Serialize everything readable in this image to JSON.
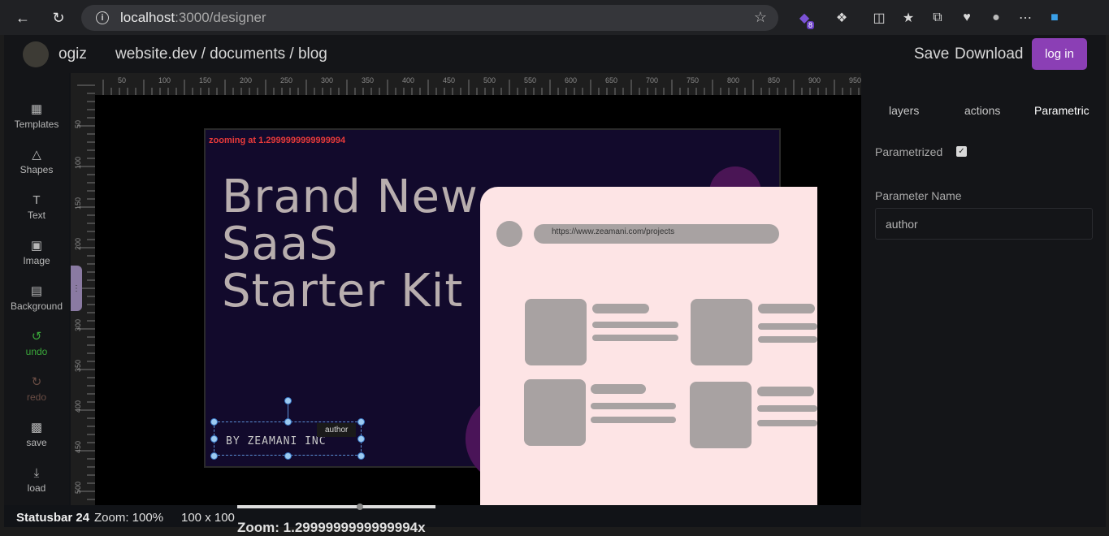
{
  "browser": {
    "url_host": "localhost",
    "url_path": ":3000/designer",
    "extension_badge": "8"
  },
  "header": {
    "username": "ogiz",
    "breadcrumb": "website.dev / documents / blog",
    "save_label": "Save",
    "download_label": "Download",
    "login_label": "log in"
  },
  "sidebar": {
    "items": [
      {
        "label": "Templates",
        "icon": "grid-icon"
      },
      {
        "label": "Shapes",
        "icon": "shapes-icon"
      },
      {
        "label": "Text",
        "icon": "text-icon"
      },
      {
        "label": "Image",
        "icon": "image-icon"
      },
      {
        "label": "Background",
        "icon": "hatch-icon"
      },
      {
        "label": "undo",
        "icon": "undo-icon"
      },
      {
        "label": "redo",
        "icon": "redo-icon"
      },
      {
        "label": "save",
        "icon": "floppy-icon"
      },
      {
        "label": "load",
        "icon": "download-icon"
      }
    ]
  },
  "rulers": {
    "top": [
      "50",
      "100",
      "150",
      "200",
      "250",
      "300",
      "350",
      "400",
      "450",
      "500",
      "550",
      "600",
      "650",
      "700",
      "750",
      "800",
      "850",
      "900",
      "950"
    ],
    "left": [
      "50",
      "100",
      "150",
      "200",
      "250",
      "300",
      "350",
      "400",
      "450",
      "500"
    ]
  },
  "canvas": {
    "zoom_message": "zooming at 1.2999999999999994",
    "headline_lines": [
      "Brand New",
      "SaaS",
      "Starter Kit"
    ],
    "mock_url": "https://www.zeamani.com/projects",
    "author_text": "BY ZEAMANI INC",
    "author_badge": "author"
  },
  "statusbar": {
    "label": "Statusbar 24",
    "zoom": "Zoom: 100%",
    "size": "100 x 100",
    "zoom_detail": "Zoom: 1.2999999999999994x"
  },
  "right_panel": {
    "tabs": [
      "layers",
      "actions",
      "Parametric"
    ],
    "active_tab": "Parametric",
    "parametrized_label": "Parametrized",
    "parametrized_checked": true,
    "parameter_name_label": "Parameter Name",
    "parameter_name_value": "author"
  }
}
